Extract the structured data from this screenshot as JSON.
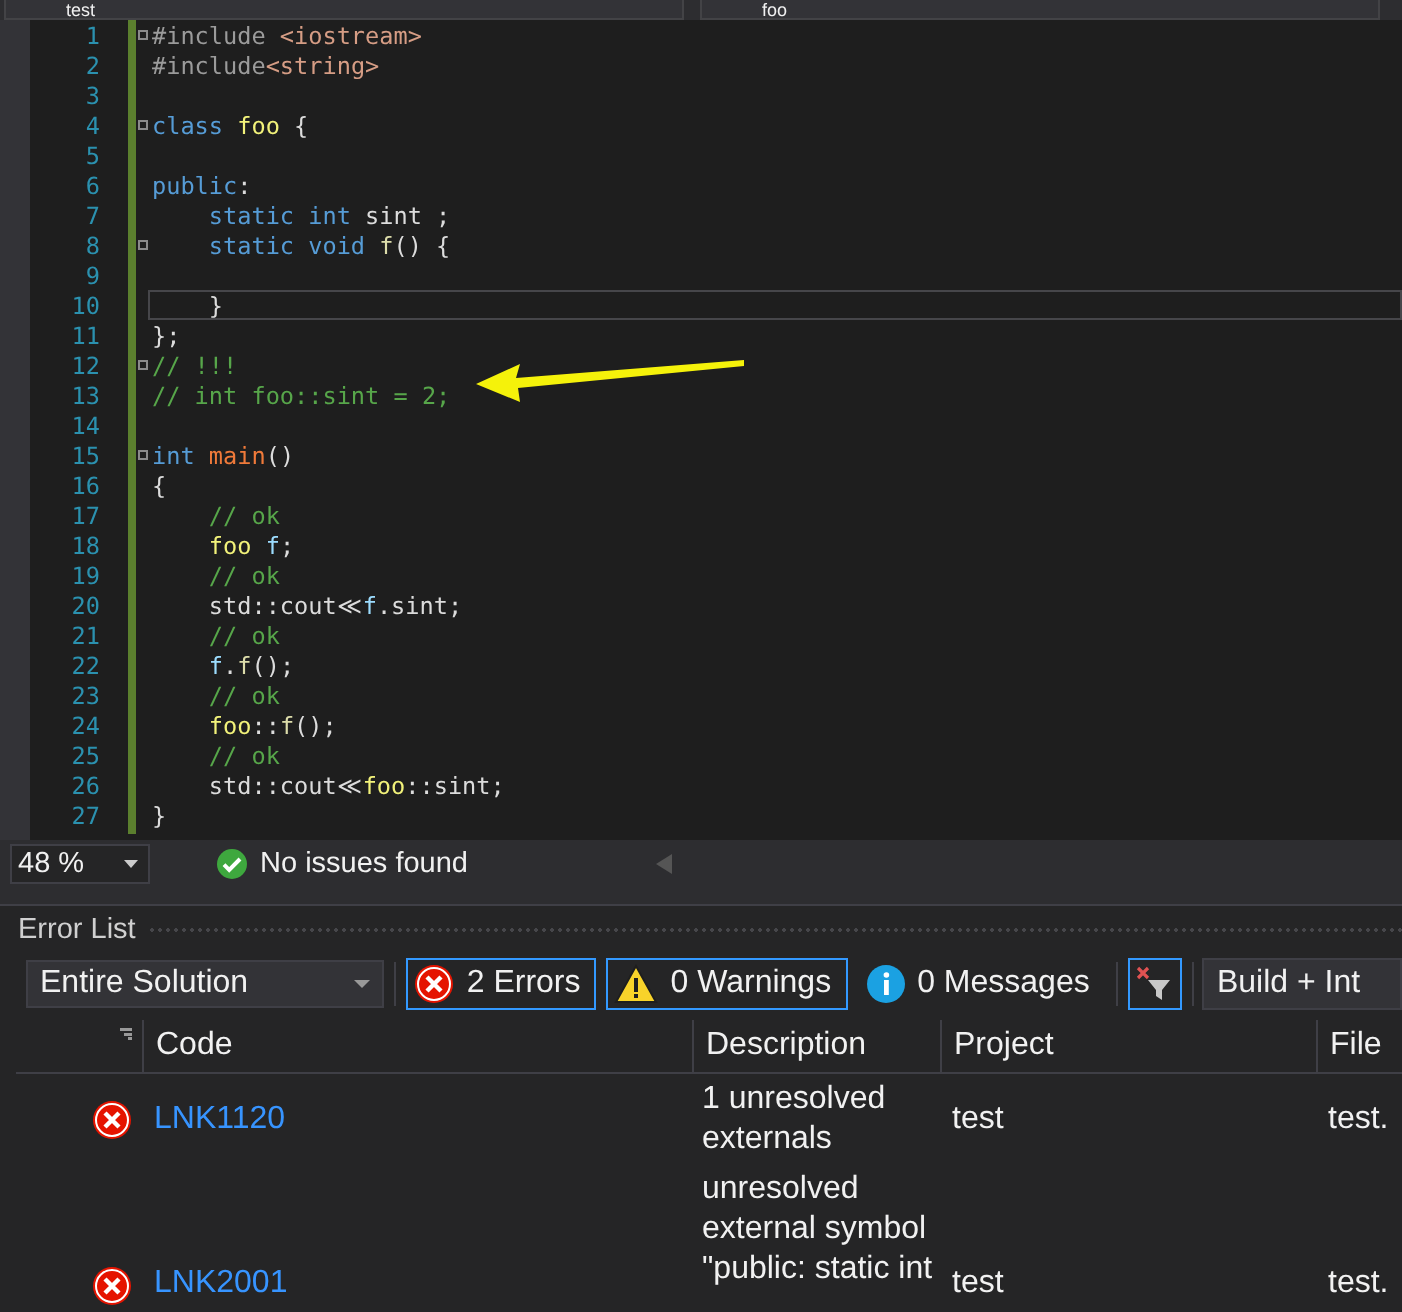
{
  "top_bar": {
    "project_dropdown": "test",
    "scope_dropdown": "foo"
  },
  "editor": {
    "lines": [
      {
        "number": "1",
        "fold": true,
        "current": false,
        "indent": false,
        "tokens": [
          {
            "kind": "pre",
            "text": "#include "
          },
          {
            "kind": "str",
            "text": "<iostream>"
          }
        ]
      },
      {
        "number": "2",
        "fold": false,
        "current": false,
        "indent": false,
        "tokens": [
          {
            "kind": "pre",
            "text": "#include"
          },
          {
            "kind": "str",
            "text": "<string>"
          }
        ]
      },
      {
        "number": "3",
        "fold": false,
        "current": false
      },
      {
        "number": "4",
        "fold": true,
        "current": false,
        "indent": false,
        "tokens": [
          {
            "kind": "kw",
            "text": "class "
          },
          {
            "kind": "type",
            "text": "foo"
          },
          {
            "kind": "plain",
            "text": " {"
          }
        ]
      },
      {
        "number": "5",
        "fold": false,
        "current": false
      },
      {
        "number": "6",
        "fold": false,
        "current": false,
        "indent": false,
        "tokens": [
          {
            "kind": "kw",
            "text": "public"
          },
          {
            "kind": "plain",
            "text": ":"
          }
        ]
      },
      {
        "number": "7",
        "fold": false,
        "current": false,
        "indent": true,
        "tokens": [
          {
            "kind": "kw",
            "text": "static int "
          },
          {
            "kind": "plain",
            "text": "sint ;"
          }
        ]
      },
      {
        "number": "8",
        "fold": true,
        "current": false,
        "indent": true,
        "tokens": [
          {
            "kind": "kw",
            "text": "static void "
          },
          {
            "kind": "fn",
            "text": "f"
          },
          {
            "kind": "plain",
            "text": "() {"
          }
        ]
      },
      {
        "number": "9",
        "fold": false,
        "current": false
      },
      {
        "number": "10",
        "fold": false,
        "current": true,
        "indent": true,
        "tokens": [
          {
            "kind": "plain",
            "text": "}"
          }
        ]
      },
      {
        "number": "11",
        "fold": false,
        "current": false,
        "indent": false,
        "tokens": [
          {
            "kind": "plain",
            "text": "};"
          }
        ]
      },
      {
        "number": "12",
        "fold": true,
        "current": false,
        "indent": false,
        "tokens": [
          {
            "kind": "comment",
            "text": "// !!!"
          }
        ]
      },
      {
        "number": "13",
        "fold": false,
        "current": false,
        "indent": false,
        "tokens": [
          {
            "kind": "comment",
            "text": "// int foo::sint = 2;"
          }
        ]
      },
      {
        "number": "14",
        "fold": false,
        "current": false
      },
      {
        "number": "15",
        "fold": true,
        "current": false,
        "indent": false,
        "tokens": [
          {
            "kind": "kw",
            "text": "int "
          },
          {
            "kind": "main",
            "text": "main"
          },
          {
            "kind": "plain",
            "text": "()"
          }
        ]
      },
      {
        "number": "16",
        "fold": false,
        "current": false,
        "indent": false,
        "tokens": [
          {
            "kind": "plain",
            "text": "{"
          }
        ]
      },
      {
        "number": "17",
        "fold": false,
        "current": false,
        "indent": true,
        "tokens": [
          {
            "kind": "comment",
            "text": "// ok"
          }
        ]
      },
      {
        "number": "18",
        "fold": false,
        "current": false,
        "indent": true,
        "tokens": [
          {
            "kind": "type",
            "text": "foo "
          },
          {
            "kind": "var",
            "text": "f"
          },
          {
            "kind": "plain",
            "text": ";"
          }
        ]
      },
      {
        "number": "19",
        "fold": false,
        "current": false,
        "indent": true,
        "tokens": [
          {
            "kind": "comment",
            "text": "// ok"
          }
        ]
      },
      {
        "number": "20",
        "fold": false,
        "current": false,
        "indent": true,
        "tokens": [
          {
            "kind": "plain",
            "text": "std::cout≪"
          },
          {
            "kind": "var",
            "text": "f"
          },
          {
            "kind": "plain",
            "text": ".sint;"
          }
        ]
      },
      {
        "number": "21",
        "fold": false,
        "current": false,
        "indent": true,
        "tokens": [
          {
            "kind": "comment",
            "text": "// ok"
          }
        ]
      },
      {
        "number": "22",
        "fold": false,
        "current": false,
        "indent": true,
        "tokens": [
          {
            "kind": "var",
            "text": "f"
          },
          {
            "kind": "plain",
            "text": "."
          },
          {
            "kind": "fn",
            "text": "f"
          },
          {
            "kind": "plain",
            "text": "();"
          }
        ]
      },
      {
        "number": "23",
        "fold": false,
        "current": false,
        "indent": true,
        "tokens": [
          {
            "kind": "comment",
            "text": "// ok"
          }
        ]
      },
      {
        "number": "24",
        "fold": false,
        "current": false,
        "indent": true,
        "tokens": [
          {
            "kind": "type",
            "text": "foo"
          },
          {
            "kind": "plain",
            "text": "::"
          },
          {
            "kind": "fn",
            "text": "f"
          },
          {
            "kind": "plain",
            "text": "();"
          }
        ]
      },
      {
        "number": "25",
        "fold": false,
        "current": false,
        "indent": true,
        "tokens": [
          {
            "kind": "comment",
            "text": "// ok"
          }
        ]
      },
      {
        "number": "26",
        "fold": false,
        "current": false,
        "indent": true,
        "tokens": [
          {
            "kind": "plain",
            "text": "std::cout≪"
          },
          {
            "kind": "type",
            "text": "foo"
          },
          {
            "kind": "plain",
            "text": "::sint;"
          }
        ]
      },
      {
        "number": "27",
        "fold": false,
        "current": false,
        "indent": false,
        "tokens": [
          {
            "kind": "plain",
            "text": "}"
          }
        ]
      }
    ]
  },
  "status_bar": {
    "zoom": "48 %",
    "health": "No issues found"
  },
  "error_list": {
    "title": "Error List",
    "scope": "Entire Solution",
    "filters": [
      {
        "kind": "error",
        "label": "2 Errors",
        "selected": true
      },
      {
        "kind": "warning",
        "label": "0 Warnings",
        "selected": true
      },
      {
        "kind": "info",
        "label": "0 Messages",
        "selected": false
      }
    ],
    "build_dropdown": "Build + Int",
    "columns": [
      "Code",
      "Description",
      "Project",
      "File"
    ],
    "rows": [
      {
        "kind": "error",
        "code": "LNK1120",
        "description": "1 unresolved externals",
        "project": "test",
        "file": "test."
      },
      {
        "kind": "error",
        "code": "LNK2001",
        "description": "unresolved external symbol \"public: static int",
        "project": "test",
        "file": "test."
      }
    ]
  }
}
